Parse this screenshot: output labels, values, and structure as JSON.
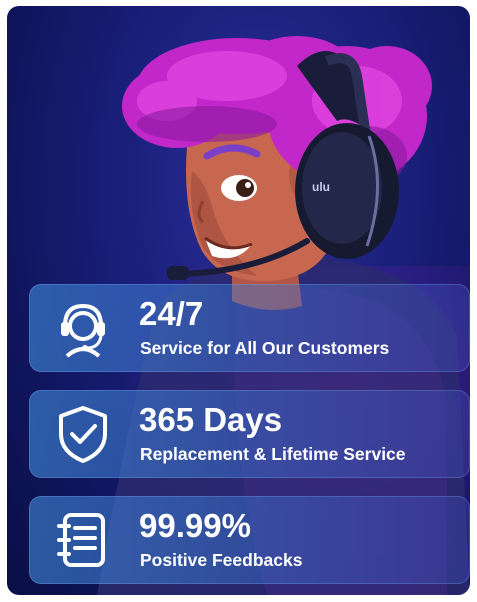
{
  "features": [
    {
      "icon": "headset-agent-icon",
      "headline": "24/7",
      "caption": "Service for All Our Customers"
    },
    {
      "icon": "shield-check-icon",
      "headline": "365 Days",
      "caption": "Replacement & Lifetime Service"
    },
    {
      "icon": "notebook-list-icon",
      "headline": "99.99%",
      "caption": "Positive Feedbacks"
    }
  ],
  "headset_logo": "ulu"
}
